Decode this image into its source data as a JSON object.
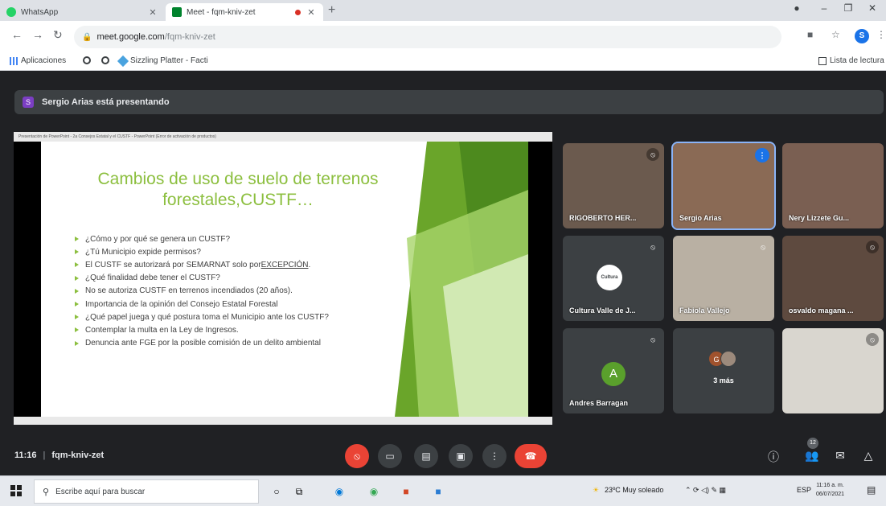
{
  "browser": {
    "tabs": [
      {
        "title": "WhatsApp",
        "favicon_color": "#25d366"
      },
      {
        "title": "Meet - fqm-kniv-zet",
        "favicon_color": "#00832d"
      }
    ],
    "address": {
      "domain": "meet.google.com",
      "path": "/fqm-kniv-zet"
    },
    "profile_initial": "S",
    "bookmarks": {
      "apps": "Aplicaciones",
      "sizzling": "Sizzling Platter - Facti",
      "reading_list": "Lista de lectura"
    }
  },
  "meet": {
    "presenting_banner": {
      "initial": "S",
      "text": "Sergio Arias está presentando"
    },
    "slide": {
      "window_title": "Presentación de PowerPoint - 2a Consejos Estatal y el CUSTF - PowerPoint (Error de activación de productos)",
      "title": "Cambios de uso de suelo de terrenos forestales,CUSTF…",
      "bullets": [
        {
          "text": "¿Cómo y por qué se genera un CUSTF?"
        },
        {
          "text": "¿Tú Municipio expide permisos?"
        },
        {
          "text": "El CUSTF se autorizará por SEMARNAT solo por ",
          "underlined": "EXCEPCIÓN",
          "after": "."
        },
        {
          "text": "¿Qué finalidad debe tener el CUSTF?"
        },
        {
          "text": "No se autoriza CUSTF en terrenos incendiados (20 años)."
        },
        {
          "text": "Importancia de la opinión del Consejo Estatal Forestal"
        },
        {
          "text": "¿Qué papel juega y qué postura toma el Municipio ante los CUSTF?"
        },
        {
          "text": "Contemplar la multa en la Ley de Ingresos."
        },
        {
          "text": "Denuncia ante FGE por la posible comisión de un delito ambiental"
        }
      ]
    },
    "participants": [
      {
        "name": "RIGOBERTO HER..."
      },
      {
        "name": "Sergio Arias"
      },
      {
        "name": "Nery Lizzete Gu..."
      },
      {
        "name": "Cultura Valle de J...",
        "logo_text": "Cultura"
      },
      {
        "name": "Fabiola Vallejo"
      },
      {
        "name": "osvaldo magana ..."
      },
      {
        "name": "Andres Barragan",
        "initial": "A"
      },
      {
        "more_label": "3 más",
        "avatars": [
          "G",
          ""
        ]
      },
      {
        "name": ""
      }
    ],
    "bottom_bar": {
      "time": "11:16",
      "meeting_code": "fqm-kniv-zet",
      "participant_count": "12"
    }
  },
  "taskbar": {
    "search_placeholder": "Escribe aquí para buscar",
    "weather": "23ºC  Muy soleado",
    "language": "ESP",
    "time": "11:16 a. m.",
    "date": "06/07/2021"
  },
  "colors": {
    "slide_accent": "#8cbf3f",
    "hangup": "#ea4335",
    "mic_off": "#ea4335",
    "speaking": "#1a73e8"
  }
}
